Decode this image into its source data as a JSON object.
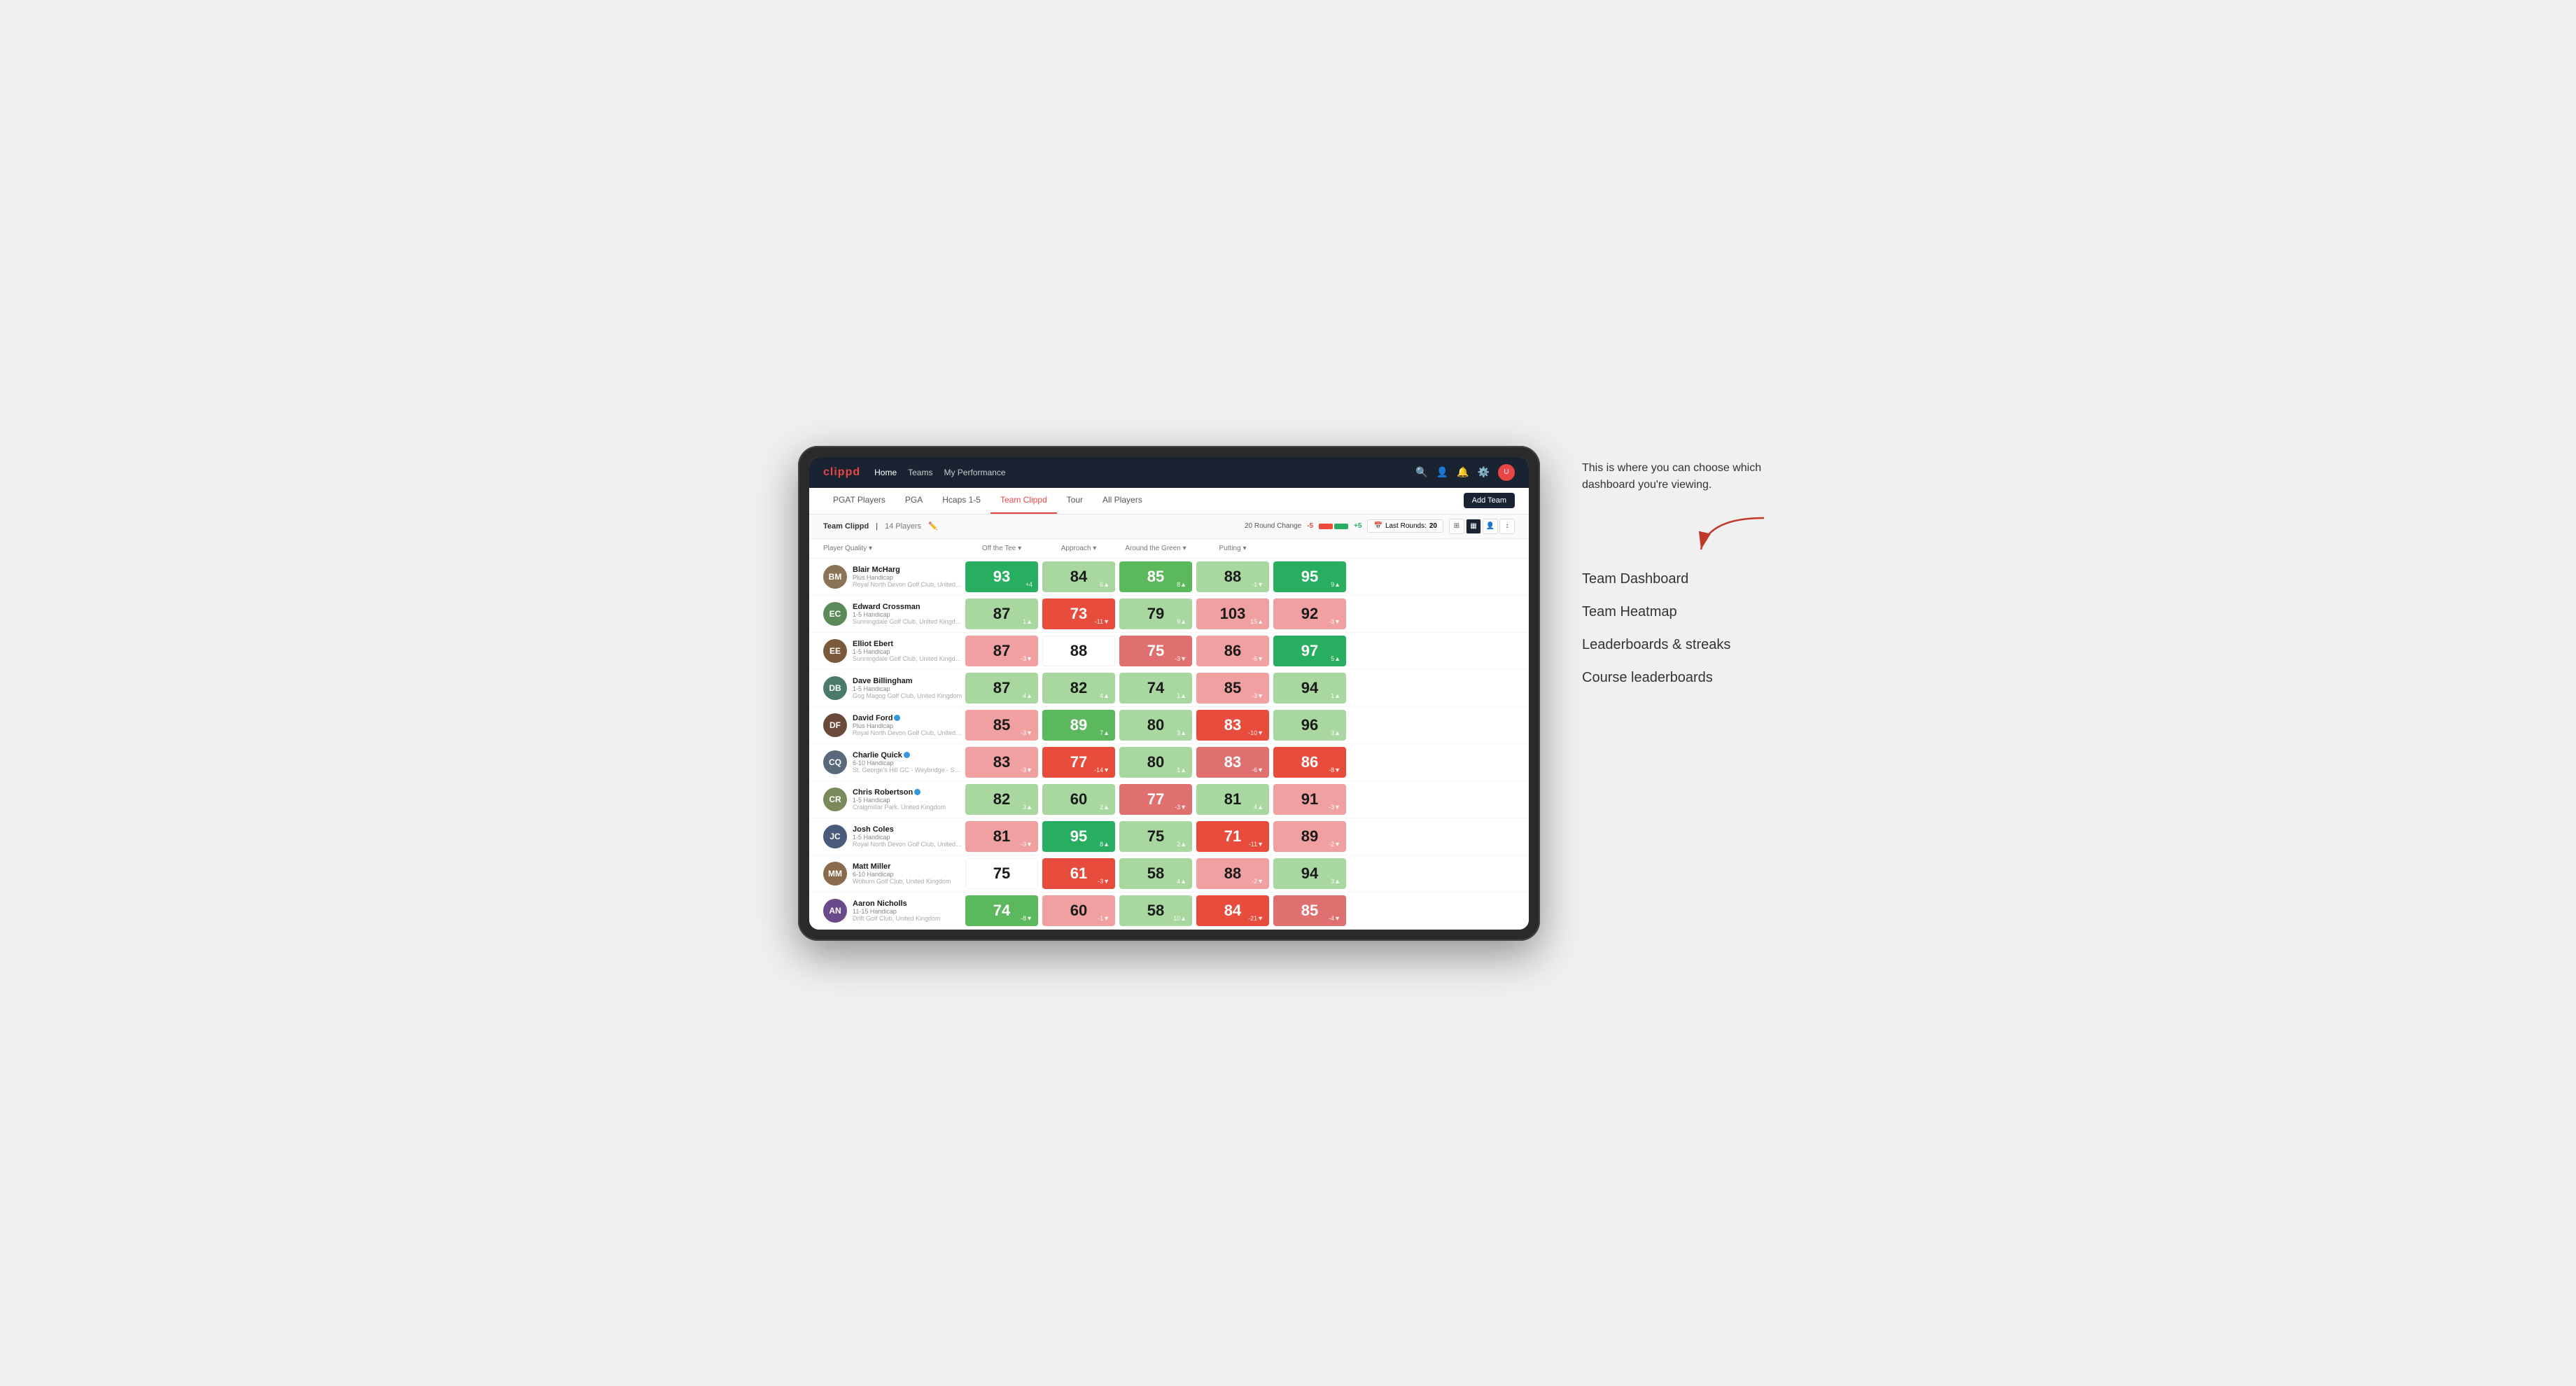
{
  "app": {
    "logo": "clippd",
    "nav": {
      "links": [
        "Home",
        "Teams",
        "My Performance"
      ],
      "icons": [
        "search",
        "person",
        "bell",
        "settings",
        "avatar"
      ]
    },
    "sub_nav": {
      "tabs": [
        "PGAT Players",
        "PGA",
        "Hcaps 1-5",
        "Team Clippd",
        "Tour",
        "All Players"
      ],
      "active": "Team Clippd",
      "add_team_label": "Add Team"
    }
  },
  "team_header": {
    "team_label": "Team Clippd",
    "separator": "|",
    "count_label": "14 Players",
    "round_change_label": "20 Round Change",
    "neg_value": "-5",
    "pos_value": "+5",
    "last_rounds_label": "Last Rounds:",
    "last_rounds_value": "20"
  },
  "columns": {
    "player": "Player Quality ▾",
    "off_tee": "Off the Tee ▾",
    "approach": "Approach ▾",
    "around_green": "Around the Green ▾",
    "putting": "Putting ▾"
  },
  "players": [
    {
      "name": "Blair McHarg",
      "handicap": "Plus Handicap",
      "club": "Royal North Devon Golf Club, United Kingdom",
      "initials": "BM",
      "color": "#8B7355",
      "scores": {
        "quality": {
          "value": 93,
          "change": "+4",
          "dir": "up",
          "bg": "green-strong"
        },
        "off_tee": {
          "value": 84,
          "change": "6▲",
          "dir": "up",
          "bg": "green-light"
        },
        "approach": {
          "value": 85,
          "change": "8▲",
          "dir": "up",
          "bg": "green-medium"
        },
        "around_green": {
          "value": 88,
          "change": "-1▼",
          "dir": "down",
          "bg": "green-light"
        },
        "putting": {
          "value": 95,
          "change": "9▲",
          "dir": "up",
          "bg": "green-strong"
        }
      }
    },
    {
      "name": "Edward Crossman",
      "handicap": "1-5 Handicap",
      "club": "Sunningdale Golf Club, United Kingdom",
      "initials": "EC",
      "color": "#5a8a5a",
      "scores": {
        "quality": {
          "value": 87,
          "change": "1▲",
          "dir": "up",
          "bg": "green-light"
        },
        "off_tee": {
          "value": 73,
          "change": "-11▼",
          "dir": "down",
          "bg": "red-strong"
        },
        "approach": {
          "value": 79,
          "change": "9▲",
          "dir": "up",
          "bg": "green-light"
        },
        "around_green": {
          "value": 103,
          "change": "15▲",
          "dir": "up",
          "bg": "red-light"
        },
        "putting": {
          "value": 92,
          "change": "-3▼",
          "dir": "down",
          "bg": "red-light"
        }
      }
    },
    {
      "name": "Elliot Ebert",
      "handicap": "1-5 Handicap",
      "club": "Sunningdale Golf Club, United Kingdom",
      "initials": "EE",
      "color": "#7a5a3a",
      "scores": {
        "quality": {
          "value": 87,
          "change": "-3▼",
          "dir": "down",
          "bg": "red-light"
        },
        "off_tee": {
          "value": 88,
          "change": "",
          "dir": "none",
          "bg": "white"
        },
        "approach": {
          "value": 75,
          "change": "-3▼",
          "dir": "down",
          "bg": "red-medium"
        },
        "around_green": {
          "value": 86,
          "change": "-6▼",
          "dir": "down",
          "bg": "red-light"
        },
        "putting": {
          "value": 97,
          "change": "5▲",
          "dir": "up",
          "bg": "green-strong"
        }
      }
    },
    {
      "name": "Dave Billingham",
      "handicap": "1-5 Handicap",
      "club": "Gog Magog Golf Club, United Kingdom",
      "initials": "DB",
      "color": "#4a7a6a",
      "scores": {
        "quality": {
          "value": 87,
          "change": "4▲",
          "dir": "up",
          "bg": "green-light"
        },
        "off_tee": {
          "value": 82,
          "change": "4▲",
          "dir": "up",
          "bg": "green-light"
        },
        "approach": {
          "value": 74,
          "change": "1▲",
          "dir": "up",
          "bg": "green-light"
        },
        "around_green": {
          "value": 85,
          "change": "-3▼",
          "dir": "down",
          "bg": "red-light"
        },
        "putting": {
          "value": 94,
          "change": "1▲",
          "dir": "up",
          "bg": "green-light"
        }
      }
    },
    {
      "name": "David Ford",
      "handicap": "Plus Handicap",
      "club": "Royal North Devon Golf Club, United Kingdom",
      "initials": "DF",
      "verified": true,
      "color": "#6a4a3a",
      "scores": {
        "quality": {
          "value": 85,
          "change": "-3▼",
          "dir": "down",
          "bg": "red-light"
        },
        "off_tee": {
          "value": 89,
          "change": "7▲",
          "dir": "up",
          "bg": "green-medium"
        },
        "approach": {
          "value": 80,
          "change": "3▲",
          "dir": "up",
          "bg": "green-light"
        },
        "around_green": {
          "value": 83,
          "change": "-10▼",
          "dir": "down",
          "bg": "red-strong"
        },
        "putting": {
          "value": 96,
          "change": "3▲",
          "dir": "up",
          "bg": "green-light"
        }
      }
    },
    {
      "name": "Charlie Quick",
      "handicap": "6-10 Handicap",
      "club": "St. George's Hill GC - Weybridge - Surrey, Uni...",
      "initials": "CQ",
      "verified": true,
      "color": "#5a6a7a",
      "scores": {
        "quality": {
          "value": 83,
          "change": "-3▼",
          "dir": "down",
          "bg": "red-light"
        },
        "off_tee": {
          "value": 77,
          "change": "-14▼",
          "dir": "down",
          "bg": "red-strong"
        },
        "approach": {
          "value": 80,
          "change": "1▲",
          "dir": "up",
          "bg": "green-light"
        },
        "around_green": {
          "value": 83,
          "change": "-6▼",
          "dir": "down",
          "bg": "red-medium"
        },
        "putting": {
          "value": 86,
          "change": "-8▼",
          "dir": "down",
          "bg": "red-strong"
        }
      }
    },
    {
      "name": "Chris Robertson",
      "handicap": "1-5 Handicap",
      "club": "Craigmillar Park, United Kingdom",
      "initials": "CR",
      "verified": true,
      "color": "#7a8a5a",
      "scores": {
        "quality": {
          "value": 82,
          "change": "3▲",
          "dir": "up",
          "bg": "green-light"
        },
        "off_tee": {
          "value": 60,
          "change": "2▲",
          "dir": "up",
          "bg": "green-light"
        },
        "approach": {
          "value": 77,
          "change": "-3▼",
          "dir": "down",
          "bg": "red-medium"
        },
        "around_green": {
          "value": 81,
          "change": "4▲",
          "dir": "up",
          "bg": "green-light"
        },
        "putting": {
          "value": 91,
          "change": "-3▼",
          "dir": "down",
          "bg": "red-light"
        }
      }
    },
    {
      "name": "Josh Coles",
      "handicap": "1-5 Handicap",
      "club": "Royal North Devon Golf Club, United Kingdom",
      "initials": "JC",
      "color": "#4a5a7a",
      "scores": {
        "quality": {
          "value": 81,
          "change": "-3▼",
          "dir": "down",
          "bg": "red-light"
        },
        "off_tee": {
          "value": 95,
          "change": "8▲",
          "dir": "up",
          "bg": "green-strong"
        },
        "approach": {
          "value": 75,
          "change": "2▲",
          "dir": "up",
          "bg": "green-light"
        },
        "around_green": {
          "value": 71,
          "change": "-11▼",
          "dir": "down",
          "bg": "red-strong"
        },
        "putting": {
          "value": 89,
          "change": "-2▼",
          "dir": "down",
          "bg": "red-light"
        }
      }
    },
    {
      "name": "Matt Miller",
      "handicap": "6-10 Handicap",
      "club": "Woburn Golf Club, United Kingdom",
      "initials": "MM",
      "color": "#8a6a4a",
      "scores": {
        "quality": {
          "value": 75,
          "change": "",
          "dir": "none",
          "bg": "white"
        },
        "off_tee": {
          "value": 61,
          "change": "-3▼",
          "dir": "down",
          "bg": "red-strong"
        },
        "approach": {
          "value": 58,
          "change": "4▲",
          "dir": "up",
          "bg": "green-light"
        },
        "around_green": {
          "value": 88,
          "change": "-2▼",
          "dir": "down",
          "bg": "red-light"
        },
        "putting": {
          "value": 94,
          "change": "3▲",
          "dir": "up",
          "bg": "green-light"
        }
      }
    },
    {
      "name": "Aaron Nicholls",
      "handicap": "11-15 Handicap",
      "club": "Drift Golf Club, United Kingdom",
      "initials": "AN",
      "color": "#6a4a8a",
      "scores": {
        "quality": {
          "value": 74,
          "change": "-8▼",
          "dir": "down",
          "bg": "green-medium"
        },
        "off_tee": {
          "value": 60,
          "change": "-1▼",
          "dir": "down",
          "bg": "red-light"
        },
        "approach": {
          "value": 58,
          "change": "10▲",
          "dir": "up",
          "bg": "green-light"
        },
        "around_green": {
          "value": 84,
          "change": "-21▼",
          "dir": "down",
          "bg": "red-strong"
        },
        "putting": {
          "value": 85,
          "change": "-4▼",
          "dir": "down",
          "bg": "red-medium"
        }
      }
    }
  ],
  "annotation": {
    "intro_text": "This is where you can choose which dashboard you're viewing.",
    "options": [
      "Team Dashboard",
      "Team Heatmap",
      "Leaderboards & streaks",
      "Course leaderboards"
    ]
  },
  "avatar_colors": {
    "BM": "#8B7355",
    "EC": "#5a8a5a",
    "EE": "#7a5a3a",
    "DB": "#4a7a6a",
    "DF": "#6a4a3a",
    "CQ": "#5a6a7a",
    "CR": "#7a8a5a",
    "JC": "#4a5a7a",
    "MM": "#8a6a4a",
    "AN": "#6a4a8a"
  }
}
